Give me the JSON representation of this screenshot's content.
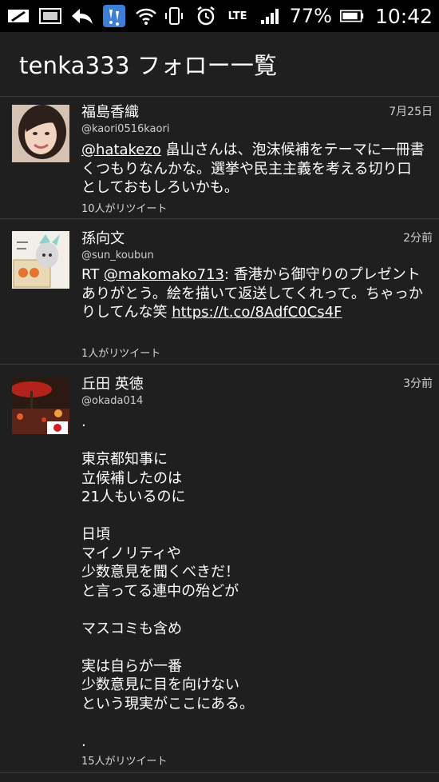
{
  "status_bar": {
    "battery_percent": "77%",
    "time": "10:42",
    "network": "LTE",
    "icons": [
      "pen-icon",
      "image-icon",
      "back-arrow-icon",
      "app-notification-icon",
      "wifi-icon",
      "phone-vibrate-icon",
      "alarm-icon",
      "lte-icon",
      "signal-icon",
      "battery-icon"
    ]
  },
  "header": {
    "title": "tenka333 フォロー一覧"
  },
  "tweets": [
    {
      "name": "福島香織",
      "handle": "@kaori0516kaori",
      "time": "7月25日",
      "mention": "@hatakezo",
      "text": " 畠山さんは、泡沫候補をテーマに一冊書くつもりなんかな。選挙や民主主義を考える切り口としておもしろいかも。",
      "retweets": "10人がリツイート"
    },
    {
      "name": "孫向文",
      "handle": "@sun_koubun",
      "time": "2分前",
      "prefix": "RT ",
      "mention": "@makomako713",
      "text": ": 香港から御守りのプレゼントありがとう。絵を描いて返送してくれって。ちゃっかりしてんな笑 ",
      "link": "https://t.co/8AdfC0Cs4F",
      "retweets": "1人がリツイート"
    },
    {
      "name": "丘田 英徳",
      "handle": "@okada014",
      "time": "3分前",
      "text": ".\n\n東京都知事に\n立候補したのは\n21人もいるのに\n\n日頃\nマイノリティや\n少数意見を聞くべきだ！\nと言ってる連中の殆どが\n\nマスコミも含め\n\n実は自らが一番\n少数意見に目を向けない\nという現実がここにある。\n\n.",
      "retweets": "15人がリツイート"
    }
  ],
  "colors": {
    "background": "#1f1f1f",
    "statusbar": "#000000",
    "divider": "#3a3a3a",
    "text": "#ffffff",
    "meta_text": "#cfcfcf"
  }
}
